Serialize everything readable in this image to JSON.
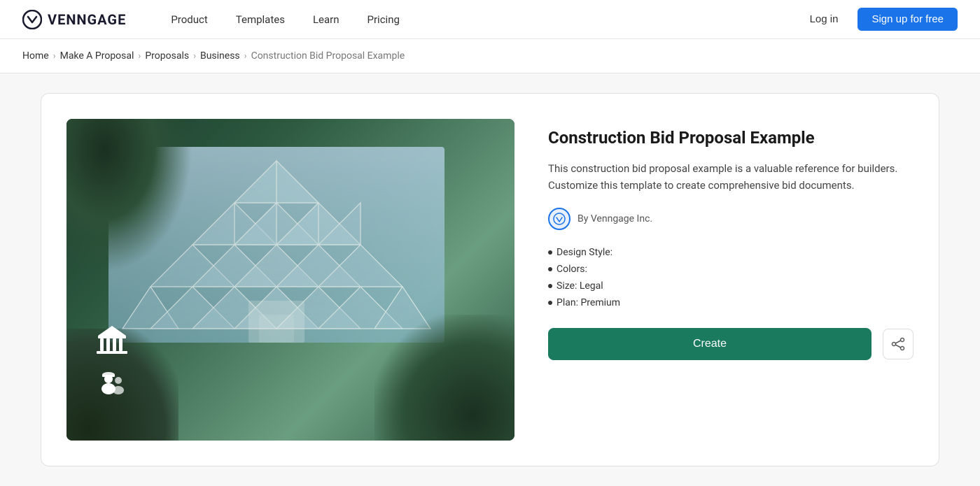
{
  "brand": {
    "name": "VENNGAGE",
    "logo_alt": "Venngage logo"
  },
  "nav": {
    "items": [
      {
        "label": "Product",
        "id": "product"
      },
      {
        "label": "Templates",
        "id": "templates"
      },
      {
        "label": "Learn",
        "id": "learn"
      },
      {
        "label": "Pricing",
        "id": "pricing"
      }
    ],
    "login_label": "Log in",
    "signup_label": "Sign up for free"
  },
  "breadcrumb": {
    "items": [
      {
        "label": "Home",
        "link": true
      },
      {
        "label": "Make A Proposal",
        "link": true
      },
      {
        "label": "Proposals",
        "link": true
      },
      {
        "label": "Business",
        "link": true
      },
      {
        "label": "Construction Bid Proposal Example",
        "link": false
      }
    ]
  },
  "template": {
    "title": "Construction Bid Proposal Example",
    "description": "This construction bid proposal example is a valuable reference for builders. Customize this template to create comprehensive bid documents.",
    "author": "By Venngage Inc.",
    "meta": [
      {
        "label": "Design Style:"
      },
      {
        "label": "Colors:"
      },
      {
        "label": "Size: Legal"
      },
      {
        "label": "Plan: Premium"
      }
    ],
    "create_btn": "Create",
    "share_icon_label": "share"
  }
}
